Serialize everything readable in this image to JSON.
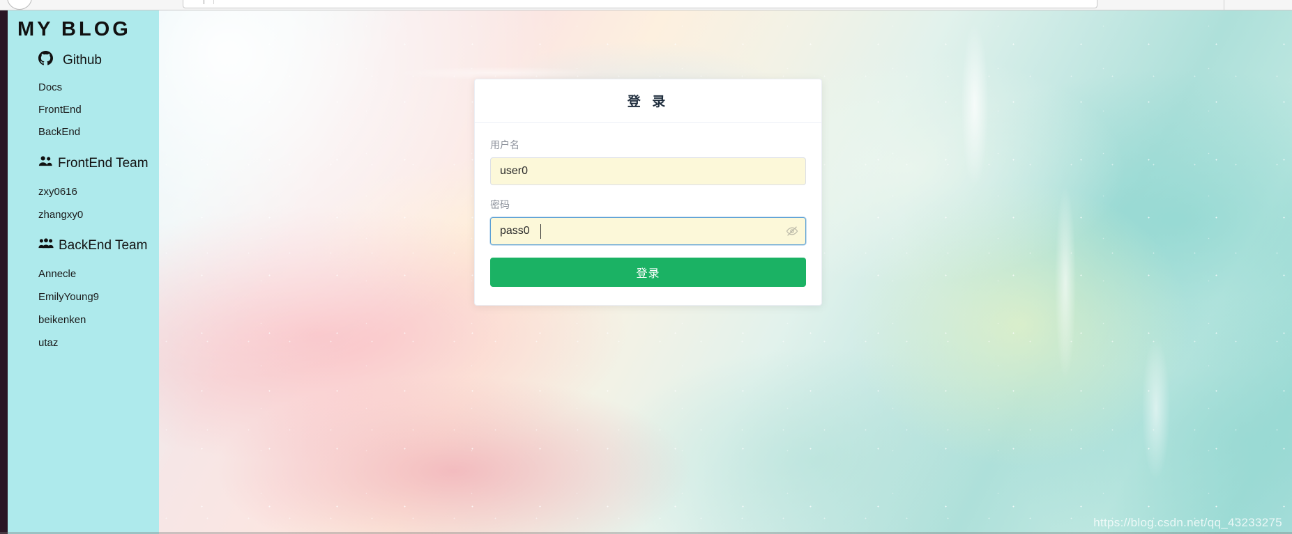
{
  "browser": {
    "back_icon": "back-circle-icon",
    "address_bar_value": ""
  },
  "sidebar": {
    "title": "MY BLOG",
    "background_color": "#aeeaec",
    "github": {
      "icon": "github-icon",
      "label": "Github"
    },
    "links": [
      {
        "label": "Docs"
      },
      {
        "label": "FrontEnd"
      },
      {
        "label": "BackEnd"
      }
    ],
    "sections": [
      {
        "icon": "people-group-icon",
        "title": "FrontEnd Team",
        "members": [
          {
            "label": "zxy0616"
          },
          {
            "label": "zhangxy0"
          }
        ]
      },
      {
        "icon": "people-group-icon",
        "title": "BackEnd Team",
        "members": [
          {
            "label": "Annecle"
          },
          {
            "label": "EmilyYoung9"
          },
          {
            "label": "beikenken"
          },
          {
            "label": "utaz"
          }
        ]
      }
    ]
  },
  "login_card": {
    "title": "登 录",
    "username": {
      "label": "用户名",
      "value": "user0",
      "placeholder": "用户名"
    },
    "password": {
      "label": "密码",
      "value": "pass0",
      "placeholder": "密码",
      "toggle_icon": "eye-slash-icon",
      "visible": true
    },
    "submit_label": "登录",
    "submit_color": "#1bb264"
  },
  "watermark": {
    "text": "https://blog.csdn.net/qq_43233275"
  }
}
